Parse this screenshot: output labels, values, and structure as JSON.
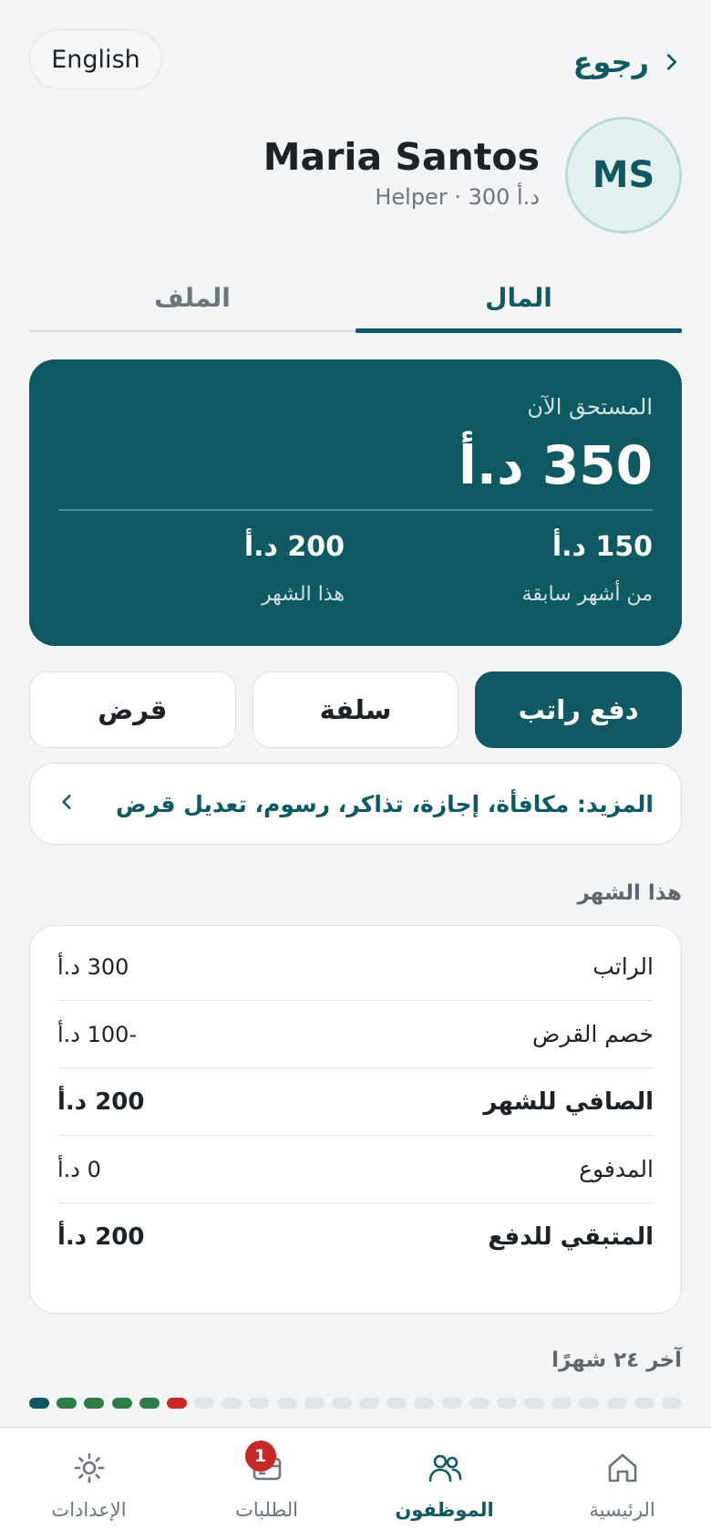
{
  "header": {
    "language_button": "English",
    "back_label": "رجوع"
  },
  "profile": {
    "initials": "MS",
    "name": "Maria Santos",
    "subline": "Helper · 300 د.أ"
  },
  "tabs": [
    {
      "label": "المال",
      "active": true
    },
    {
      "label": "الملف",
      "active": false
    }
  ],
  "balance": {
    "due_label": "المستحق الآن",
    "due_amount": "350 د.أ",
    "previous_amount": "150 د.أ",
    "previous_label": "من أشهر سابقة",
    "this_month_amount": "200 د.أ",
    "this_month_label": "هذا الشهر"
  },
  "actions": {
    "pay_salary": "دفع راتب",
    "advance": "سلفة",
    "loan": "قرض"
  },
  "more": {
    "label": "المزيد: مكافأة، إجازة، تذاكر، رسوم، تعديل قرض"
  },
  "this_month": {
    "title": "هذا الشهر",
    "rows": [
      {
        "label": "الراتب",
        "value": "300 د.أ",
        "bold": false
      },
      {
        "label": "خصم القرض",
        "value": "-100 د.أ",
        "bold": false
      },
      {
        "label": "الصافي للشهر",
        "value": "200 د.أ",
        "bold": true
      },
      {
        "label": "المدفوع",
        "value": "0 د.أ",
        "bold": false
      },
      {
        "label": "المتبقي للدفع",
        "value": "200 د.أ",
        "bold": true
      }
    ]
  },
  "history": {
    "title": "آخر ٢٤ شهرًا",
    "months": [
      "unpaid-teal",
      "paid",
      "paid",
      "paid",
      "paid",
      "overdue",
      "empty",
      "empty",
      "empty",
      "empty",
      "empty",
      "empty",
      "empty",
      "empty",
      "empty",
      "empty",
      "empty",
      "empty",
      "empty",
      "empty",
      "empty",
      "empty",
      "empty",
      "empty"
    ],
    "status_colors": {
      "unpaid-teal": "#0f5a62",
      "paid": "#2e7d46",
      "overdue": "#c62828",
      "empty": "#e1e4e6"
    }
  },
  "bottom_nav": [
    {
      "label": "الرئيسية",
      "icon": "home-icon",
      "active": false
    },
    {
      "label": "الموظفون",
      "icon": "people-icon",
      "active": true
    },
    {
      "label": "الطلبات",
      "icon": "card-icon",
      "active": false,
      "badge": "1"
    },
    {
      "label": "الإعدادات",
      "icon": "settings-icon",
      "active": false
    }
  ],
  "colors": {
    "brand": "#0f5a62",
    "background": "#f2f4f6",
    "badge": "#c62828"
  }
}
